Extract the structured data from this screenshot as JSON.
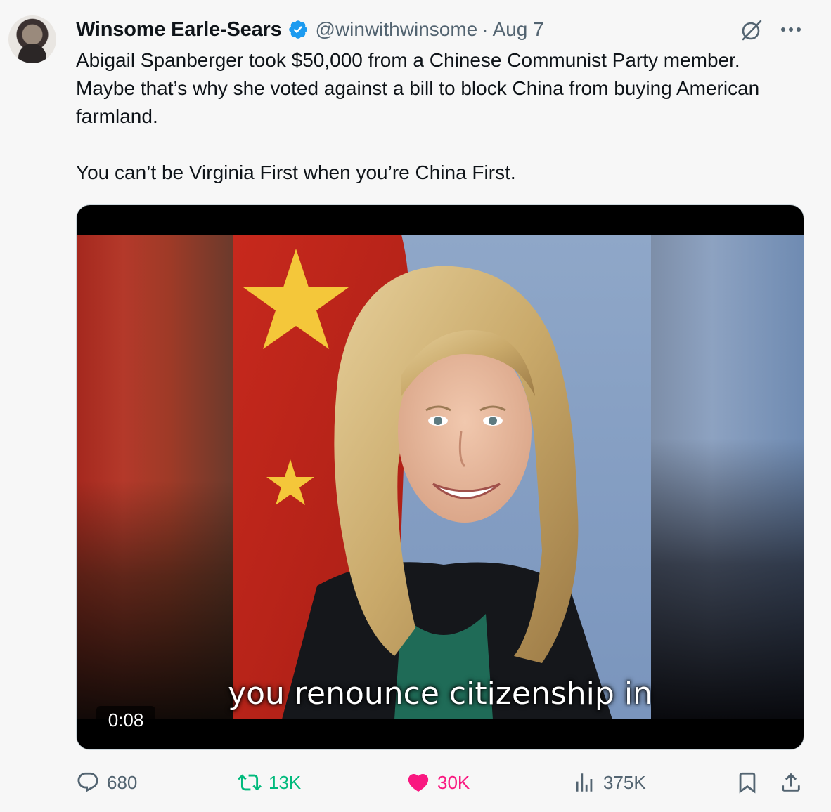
{
  "tweet": {
    "author_name": "Winsome Earle-Sears",
    "handle": "@winwithwinsome",
    "separator": "·",
    "date": "Aug 7",
    "text_paragraphs": [
      "Abigail Spanberger took $50,000 from a Chinese Communist Party member. Maybe that’s why she voted against a bill to block China from buying American farmland.",
      "You can’t be Virginia First when you’re China First."
    ]
  },
  "media": {
    "timestamp": "0:08",
    "caption": "you renounce citizenship in"
  },
  "actions": {
    "replies": "680",
    "reposts": "13K",
    "likes": "30K",
    "views": "375K"
  },
  "colors": {
    "verified": "#1d9bf0",
    "repost": "#00ba7c",
    "like": "#f91880",
    "muted": "#536471"
  },
  "icons": [
    "verified-badge-icon",
    "grok-icon",
    "more-icon",
    "reply-icon",
    "retweet-icon",
    "like-icon",
    "views-icon",
    "bookmark-icon",
    "share-icon"
  ]
}
